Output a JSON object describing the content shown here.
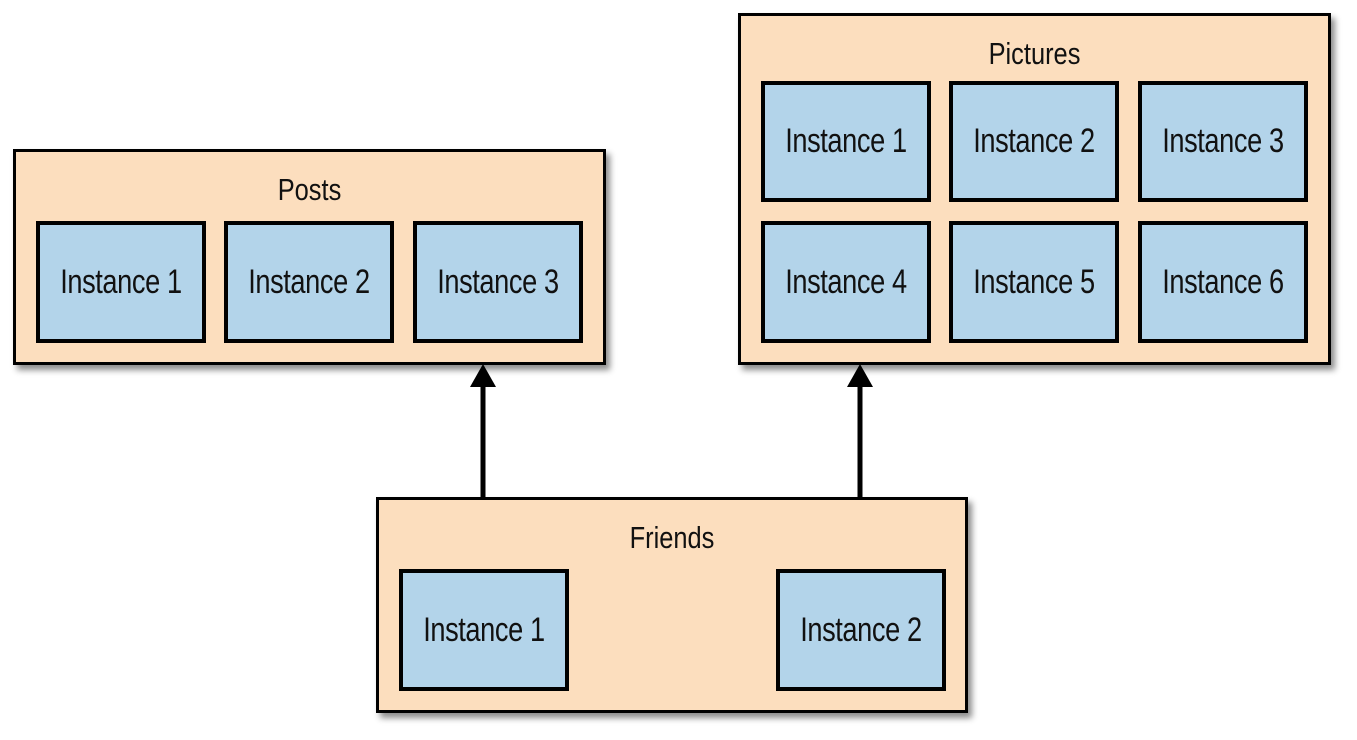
{
  "diagram": {
    "groups": {
      "posts": {
        "title": "Posts",
        "instances": [
          "Instance 1",
          "Instance 2",
          "Instance 3"
        ]
      },
      "pictures": {
        "title": "Pictures",
        "instances": [
          "Instance 1",
          "Instance 2",
          "Instance 3",
          "Instance 4",
          "Instance 5",
          "Instance 6"
        ]
      },
      "friends": {
        "title": "Friends",
        "instances": [
          "Instance 1",
          "Instance 2"
        ]
      }
    },
    "edges": [
      {
        "from": "Friends",
        "to": "Posts"
      },
      {
        "from": "Friends",
        "to": "Pictures"
      }
    ],
    "colors": {
      "group_fill": "#fcdebe",
      "instance_fill": "#b3d4ea",
      "stroke": "#000000"
    }
  }
}
